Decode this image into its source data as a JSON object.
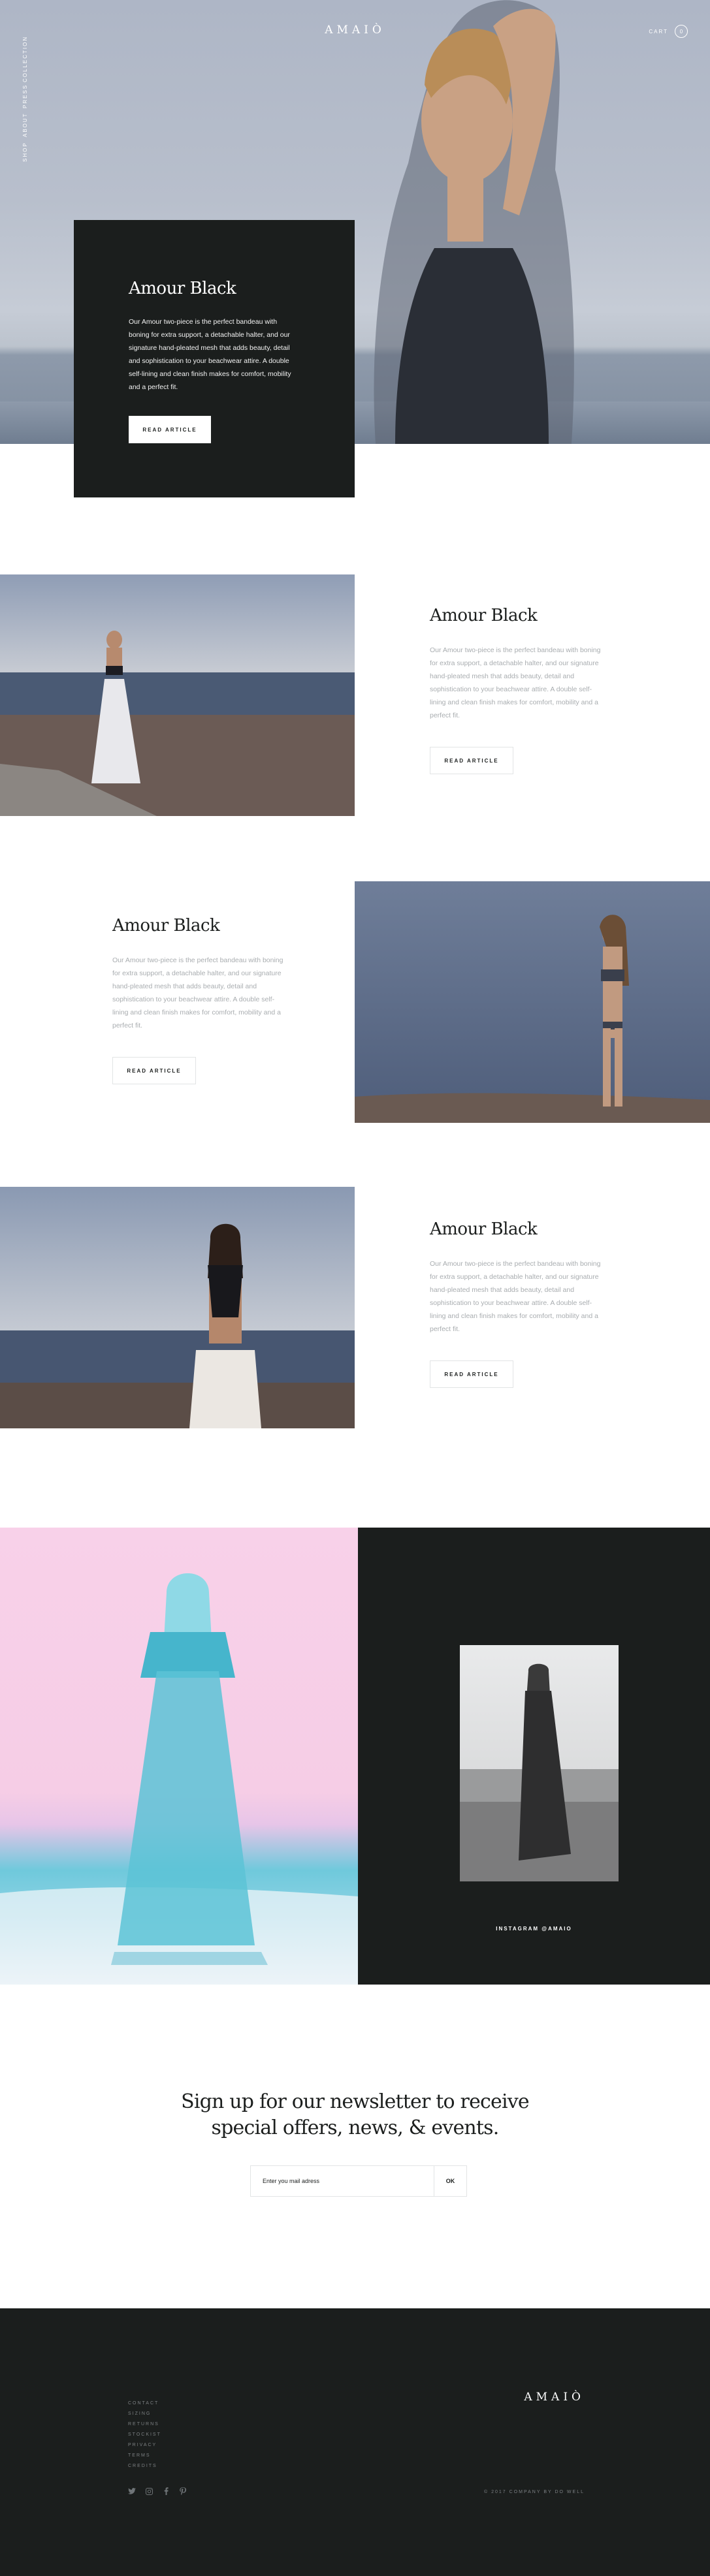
{
  "brand": "AMAIÒ",
  "nav": {
    "items": [
      {
        "label": "SHOP"
      },
      {
        "label": "ABOUT"
      },
      {
        "label": "PRESS"
      },
      {
        "label": "COLLECTION"
      }
    ],
    "cart": {
      "label": "CART",
      "count": "0"
    }
  },
  "hero": {
    "title": "Amour Black",
    "body": "Our Amour two-piece is the perfect bandeau with boning for extra support, a detachable halter, and our signature hand-pleated mesh that adds beauty, detail and sophistication to your beachwear attire. A double self-lining and clean finish makes for comfort, mobility and a perfect fit.",
    "button": "READ ARTICLE"
  },
  "articles": [
    {
      "title": "Amour Black",
      "body": "Our Amour two-piece is the perfect bandeau with boning for extra support, a detachable halter, and our signature hand-pleated mesh that adds beauty, detail and sophistication to your beachwear attire. A double self-lining and clean finish makes for comfort, mobility and a perfect fit.",
      "button": "READ ARTICLE"
    },
    {
      "title": "Amour Black",
      "body": "Our Amour two-piece is the perfect bandeau with boning for extra support, a detachable halter, and our signature hand-pleated mesh that adds beauty, detail and sophistication to your beachwear attire. A double self-lining and clean finish makes for comfort, mobility and a perfect fit.",
      "button": "READ ARTICLE"
    },
    {
      "title": "Amour Black",
      "body": "Our Amour two-piece is the perfect bandeau with boning for extra support, a detachable halter, and our signature hand-pleated mesh that adds beauty, detail and sophistication to your beachwear attire. A double self-lining and clean finish makes for comfort, mobility and a perfect fit.",
      "button": "READ ARTICLE"
    }
  ],
  "instagram": {
    "label": "INSTAGRAM @AMAIO"
  },
  "newsletter": {
    "title_line1": "Sign up for our newsletter to receive",
    "title_line2": "special offers, news, & events.",
    "placeholder": "Enter you mail adress",
    "button": "OK"
  },
  "footer": {
    "links": [
      {
        "label": "CONTACT"
      },
      {
        "label": "SIZING"
      },
      {
        "label": "RETURNS"
      },
      {
        "label": "STOCKIST"
      },
      {
        "label": "PRIVACY"
      },
      {
        "label": "TERMS"
      },
      {
        "label": "CREDITS"
      }
    ],
    "brand": "AMAIÒ",
    "copyright": "© 2017 COMPANY BY DO WELL",
    "social_icons": [
      "twitter-icon",
      "instagram-icon",
      "facebook-icon",
      "pinterest-icon"
    ]
  },
  "colors": {
    "dark": "#1b1e1d",
    "muted_text": "#a9adb0",
    "border": "#e2e4e5",
    "pink": "#f8d1e9",
    "cyan": "#6fc9dc"
  }
}
